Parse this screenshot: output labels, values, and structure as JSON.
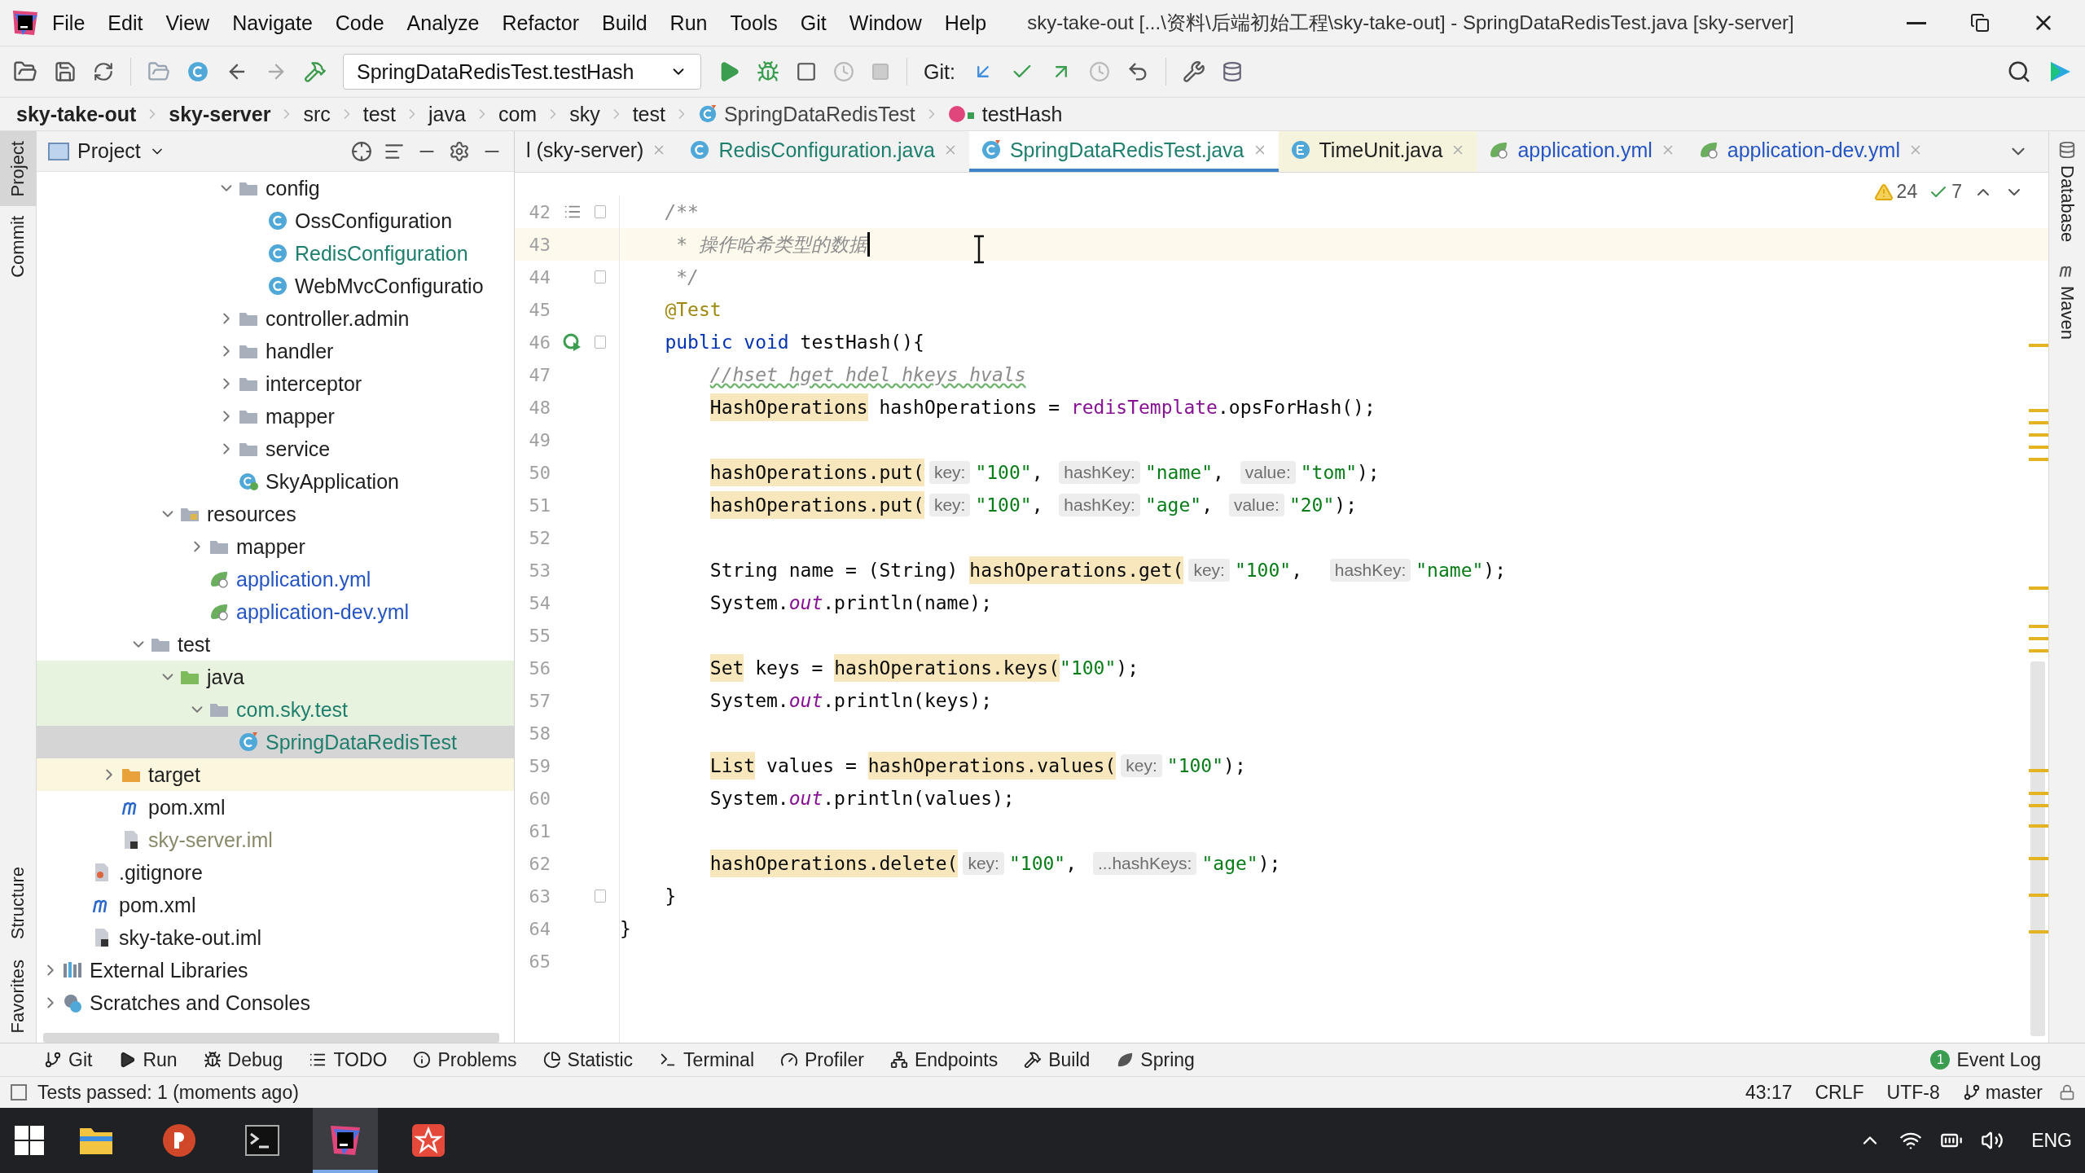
{
  "window": {
    "title": "sky-take-out [...\\资料\\后端初始工程\\sky-take-out] - SpringDataRedisTest.java [sky-server]"
  },
  "menu": [
    "File",
    "Edit",
    "View",
    "Navigate",
    "Code",
    "Analyze",
    "Refactor",
    "Build",
    "Run",
    "Tools",
    "Git",
    "Window",
    "Help"
  ],
  "toolbar": {
    "run_configuration": "SpringDataRedisTest.testHash",
    "git_label": "Git:"
  },
  "breadcrumb": [
    {
      "label": "sky-take-out",
      "kind": "module"
    },
    {
      "label": "sky-server",
      "kind": "module"
    },
    {
      "label": "src",
      "kind": "dir"
    },
    {
      "label": "test",
      "kind": "dir"
    },
    {
      "label": "java",
      "kind": "dir"
    },
    {
      "label": "com",
      "kind": "dir"
    },
    {
      "label": "sky",
      "kind": "dir"
    },
    {
      "label": "test",
      "kind": "dir"
    },
    {
      "label": "SpringDataRedisTest",
      "kind": "class"
    },
    {
      "label": "testHash",
      "kind": "method"
    }
  ],
  "left_tool_windows_top": [
    {
      "label": "Project",
      "selected": true
    },
    {
      "label": "Commit",
      "selected": false
    }
  ],
  "left_tool_windows_bottom": [
    {
      "label": "Structure",
      "selected": false
    },
    {
      "label": "Favorites",
      "selected": false
    }
  ],
  "right_tool_windows": [
    "Database",
    "Maven"
  ],
  "project_panel": {
    "title": "Project",
    "tree": [
      {
        "children": [
          {
            "children": [
              {
                "children": [
                  {
                    "children": [
                      {
                        "children": [
                          {
                            "children": [
                              {
                                "label": "config",
                                "kind": "folder",
                                "expanded": true,
                                "children": [
                                  {
                                    "label": "OssConfiguration",
                                    "kind": "class"
                                  },
                                  {
                                    "label": "RedisConfiguration",
                                    "kind": "class",
                                    "color": "#1d7f6c"
                                  },
                                  {
                                    "label": "WebMvcConfiguratio",
                                    "kind": "class"
                                  }
                                ]
                              },
                              {
                                "label": "controller.admin",
                                "kind": "folder",
                                "expanded": false
                              },
                              {
                                "label": "handler",
                                "kind": "folder",
                                "expanded": false
                              },
                              {
                                "label": "interceptor",
                                "kind": "folder",
                                "expanded": false
                              },
                              {
                                "label": "mapper",
                                "kind": "folder",
                                "expanded": false
                              },
                              {
                                "label": "service",
                                "kind": "folder",
                                "expanded": false
                              },
                              {
                                "label": "SkyApplication",
                                "kind": "boot"
                              }
                            ]
                          }
                        ]
                      },
                      {
                        "label": "resources",
                        "kind": "resources",
                        "expanded": true,
                        "children": [
                          {
                            "label": "mapper",
                            "kind": "folder",
                            "expanded": false
                          },
                          {
                            "label": "application.yml",
                            "kind": "yml",
                            "color": "#2455c3"
                          },
                          {
                            "label": "application-dev.yml",
                            "kind": "yml",
                            "color": "#2455c3"
                          }
                        ]
                      }
                    ]
                  },
                  {
                    "label": "test",
                    "kind": "folder",
                    "expanded": true,
                    "children": [
                      {
                        "label": "java",
                        "kind": "test-folder",
                        "expanded": true,
                        "children": [
                          {
                            "label": "com.sky.test",
                            "kind": "test-package",
                            "expanded": true,
                            "color": "#1d7f6c",
                            "children": [
                              {
                                "label": "SpringDataRedisTest",
                                "kind": "test-class",
                                "color": "#1d7f6c",
                                "selected": true
                              }
                            ]
                          }
                        ]
                      }
                    ]
                  }
                ]
              },
              {
                "label": "target",
                "kind": "excluded",
                "expanded": false
              },
              {
                "label": "pom.xml",
                "kind": "maven"
              },
              {
                "label": "sky-server.iml",
                "kind": "iml",
                "color": "#8a8a6a"
              }
            ]
          },
          {
            "label": ".gitignore",
            "kind": "text"
          },
          {
            "label": "pom.xml",
            "kind": "maven"
          },
          {
            "label": "sky-take-out.iml",
            "kind": "iml"
          }
        ]
      },
      {
        "label": "External Libraries",
        "kind": "library",
        "expanded": false
      },
      {
        "label": "Scratches and Consoles",
        "kind": "scratch",
        "expanded": false
      }
    ]
  },
  "editor": {
    "tabs": [
      {
        "label": "l (sky-server)",
        "kind": "cut",
        "selected": false
      },
      {
        "label": "RedisConfiguration.java",
        "kind": "class",
        "color": "#1d7f6c",
        "selected": false
      },
      {
        "label": "SpringDataRedisTest.java",
        "kind": "test-class",
        "color": "#1d7f6c",
        "selected": true
      },
      {
        "label": "TimeUnit.java",
        "kind": "library-enum",
        "selected": false
      },
      {
        "label": "application.yml",
        "kind": "yml",
        "color": "#2455c3",
        "selected": false
      },
      {
        "label": "application-dev.yml",
        "kind": "yml",
        "color": "#2455c3",
        "selected": false
      }
    ],
    "warnings": "24",
    "passed": "7",
    "lines": [
      {
        "number": "42",
        "kind": "doc",
        "fold": true,
        "current": false,
        "tokens": [
          {
            "kind": "comment",
            "text": "    /**"
          }
        ]
      },
      {
        "number": "43",
        "current": true,
        "tokens": [
          {
            "kind": "comment",
            "text": "     * 操作哈希类型的数据"
          }
        ]
      },
      {
        "number": "44",
        "fold": true,
        "current": false,
        "tokens": [
          {
            "kind": "comment",
            "text": "     */"
          }
        ]
      },
      {
        "number": "45",
        "current": false,
        "tokens": [
          {
            "kind": "annotation",
            "text": "    @Test"
          }
        ]
      },
      {
        "number": "46",
        "kind": "run",
        "fold": true,
        "current": false,
        "tokens": [
          {
            "kind": "keyword",
            "text": "    public void"
          },
          {
            "kind": "plain",
            "text": " testHash(){"
          }
        ]
      },
      {
        "number": "47",
        "current": false,
        "tokens": [
          {
            "kind": "typo-comment",
            "text": "        //hset hget hdel hkeys hvals"
          }
        ]
      },
      {
        "number": "48",
        "current": false,
        "tokens": [
          {
            "kind": "usage",
            "text": "        HashOperations"
          },
          {
            "kind": "plain",
            "text": " hashOperations = "
          },
          {
            "kind": "field",
            "text": "redisTemplate"
          },
          {
            "kind": "plain",
            "text": ".opsForHash();"
          }
        ]
      },
      {
        "number": "49",
        "current": false
      },
      {
        "number": "50",
        "current": false,
        "tokens": [
          {
            "kind": "usage",
            "text": "        hashOperations.put("
          },
          {
            "kind": "hint",
            "text": "key:"
          },
          {
            "kind": "string",
            "text": "\"100\""
          },
          {
            "kind": "plain",
            "text": ", "
          },
          {
            "kind": "hint",
            "text": "hashKey:"
          },
          {
            "kind": "string",
            "text": "\"name\""
          },
          {
            "kind": "plain",
            "text": ", "
          },
          {
            "kind": "hint",
            "text": "value:"
          },
          {
            "kind": "string",
            "text": "\"tom\""
          },
          {
            "kind": "plain",
            "text": ");"
          }
        ]
      },
      {
        "number": "51",
        "current": false,
        "tokens": [
          {
            "kind": "usage",
            "text": "        hashOperations.put("
          },
          {
            "kind": "hint",
            "text": "key:"
          },
          {
            "kind": "string",
            "text": "\"100\""
          },
          {
            "kind": "plain",
            "text": ", "
          },
          {
            "kind": "hint",
            "text": "hashKey:"
          },
          {
            "kind": "string",
            "text": "\"age\""
          },
          {
            "kind": "plain",
            "text": ", "
          },
          {
            "kind": "hint",
            "text": "value:"
          },
          {
            "kind": "string",
            "text": "\"20\""
          },
          {
            "kind": "plain",
            "text": ");"
          }
        ]
      },
      {
        "number": "52",
        "current": false
      },
      {
        "number": "53",
        "current": false,
        "tokens": [
          {
            "kind": "plain",
            "text": "        String name = (String) "
          },
          {
            "kind": "usage",
            "text": "hashOperations.get("
          },
          {
            "kind": "hint",
            "text": "key:"
          },
          {
            "kind": "string",
            "text": "\"100\""
          },
          {
            "kind": "plain",
            "text": ",  "
          },
          {
            "kind": "hint",
            "text": "hashKey:"
          },
          {
            "kind": "string",
            "text": "\"name\""
          },
          {
            "kind": "plain",
            "text": ");"
          }
        ]
      },
      {
        "number": "54",
        "current": false,
        "tokens": [
          {
            "kind": "plain",
            "text": "        System."
          },
          {
            "kind": "static",
            "text": "out"
          },
          {
            "kind": "plain",
            "text": ".println(name);"
          }
        ]
      },
      {
        "number": "55",
        "current": false
      },
      {
        "number": "56",
        "current": false,
        "tokens": [
          {
            "kind": "usage",
            "text": "        Set"
          },
          {
            "kind": "plain",
            "text": " keys = "
          },
          {
            "kind": "usage",
            "text": "hashOperations.keys("
          },
          {
            "kind": "string",
            "text": "\"100\""
          },
          {
            "kind": "plain",
            "text": ");"
          }
        ]
      },
      {
        "number": "57",
        "current": false,
        "tokens": [
          {
            "kind": "plain",
            "text": "        System."
          },
          {
            "kind": "static",
            "text": "out"
          },
          {
            "kind": "plain",
            "text": ".println(keys);"
          }
        ]
      },
      {
        "number": "58",
        "current": false
      },
      {
        "number": "59",
        "current": false,
        "tokens": [
          {
            "kind": "usage",
            "text": "        List"
          },
          {
            "kind": "plain",
            "text": " values = "
          },
          {
            "kind": "usage",
            "text": "hashOperations.values("
          },
          {
            "kind": "hint",
            "text": "key:"
          },
          {
            "kind": "string",
            "text": "\"100\""
          },
          {
            "kind": "plain",
            "text": ");"
          }
        ]
      },
      {
        "number": "60",
        "current": false,
        "tokens": [
          {
            "kind": "plain",
            "text": "        System."
          },
          {
            "kind": "static",
            "text": "out"
          },
          {
            "kind": "plain",
            "text": ".println(values);"
          }
        ]
      },
      {
        "number": "61",
        "current": false
      },
      {
        "number": "62",
        "current": false,
        "tokens": [
          {
            "kind": "usage",
            "text": "        hashOperations.delete("
          },
          {
            "kind": "hint",
            "text": "key:"
          },
          {
            "kind": "string",
            "text": "\"100\""
          },
          {
            "kind": "plain",
            "text": ", "
          },
          {
            "kind": "hint",
            "text": "...hashKeys:"
          },
          {
            "kind": "string",
            "text": "\"age\""
          },
          {
            "kind": "plain",
            "text": ");"
          }
        ]
      },
      {
        "number": "63",
        "fold": true,
        "current": false,
        "tokens": [
          {
            "kind": "plain",
            "text": "    }"
          }
        ]
      },
      {
        "number": "64",
        "current": false,
        "tokens": [
          {
            "kind": "plain",
            "text": "}"
          }
        ]
      },
      {
        "number": "65",
        "current": false
      }
    ]
  },
  "tool_windows": [
    {
      "label": "Git",
      "kind": "git"
    },
    {
      "label": "Run",
      "kind": "run"
    },
    {
      "label": "Debug",
      "kind": "debug"
    },
    {
      "label": "TODO",
      "kind": "todo"
    },
    {
      "label": "Problems",
      "kind": "problems"
    },
    {
      "label": "Statistic",
      "kind": "statistic"
    },
    {
      "label": "Terminal",
      "kind": "terminal"
    },
    {
      "label": "Profiler",
      "kind": "profiler"
    },
    {
      "label": "Endpoints",
      "kind": "endpoints"
    },
    {
      "label": "Build",
      "kind": "build"
    },
    {
      "label": "Spring",
      "kind": "spring"
    }
  ],
  "event_log": {
    "label": "Event Log",
    "count": "1"
  },
  "status_bar": {
    "message": "Tests passed: 1 (moments ago)",
    "position": "43:17",
    "line_separator": "CRLF",
    "encoding": "UTF-8",
    "branch": "master"
  },
  "taskbar": {
    "apps": [
      {
        "kind": "explorer",
        "selected": false
      },
      {
        "kind": "powerpoint",
        "selected": false
      },
      {
        "kind": "terminal",
        "selected": false
      },
      {
        "kind": "intellij",
        "selected": true
      },
      {
        "kind": "xmind",
        "selected": false
      }
    ],
    "language": "ENG"
  }
}
